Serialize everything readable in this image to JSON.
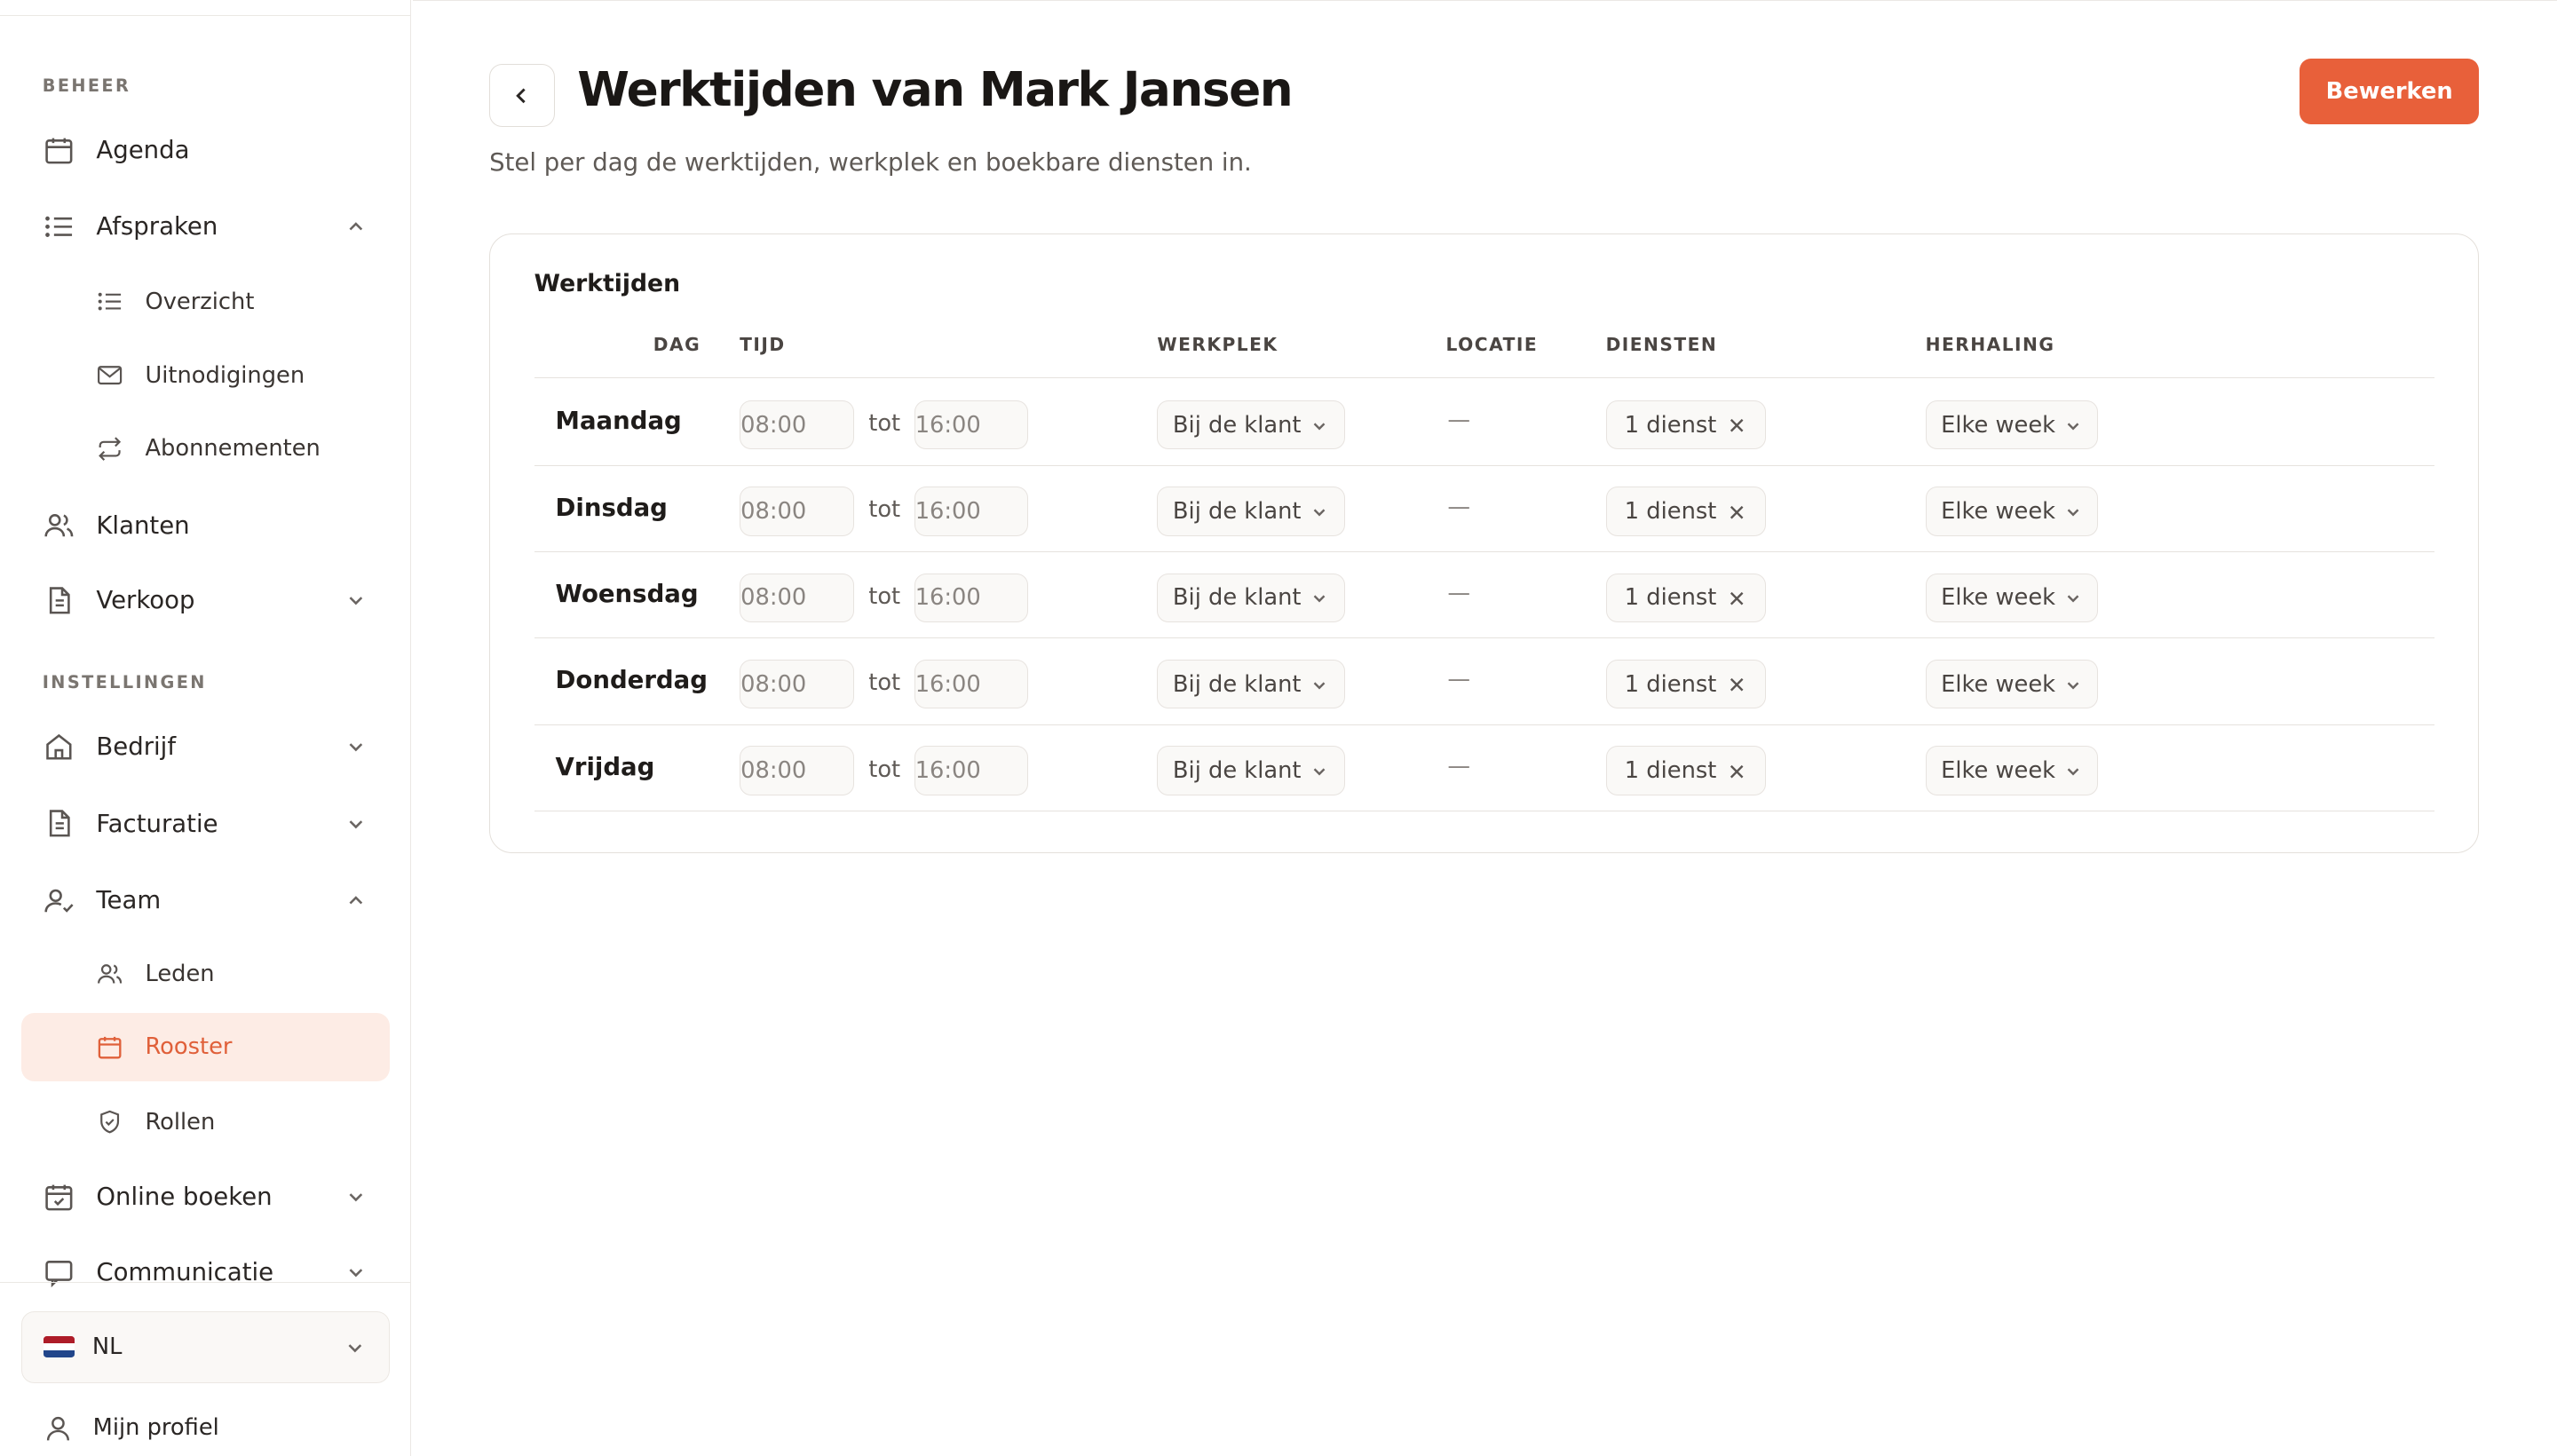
{
  "sidebar": {
    "section_beheer": "BEHEER",
    "section_instellingen": "INSTELLINGEN",
    "items": {
      "agenda": "Agenda",
      "afspraken": "Afspraken",
      "overzicht": "Overzicht",
      "uitnodigingen": "Uitnodigingen",
      "abonnementen": "Abonnementen",
      "klanten": "Klanten",
      "verkoop": "Verkoop",
      "bedrijf": "Bedrijf",
      "facturatie": "Facturatie",
      "team": "Team",
      "leden": "Leden",
      "rooster": "Rooster",
      "rollen": "Rollen",
      "online_boeken": "Online boeken",
      "communicatie": "Communicatie"
    },
    "language": "NL",
    "profile": "Mijn profiel"
  },
  "page": {
    "title": "Werktijden van Mark Jansen",
    "subtitle": "Stel per dag de werktijden, werkplek en boekbare diensten in.",
    "edit_label": "Bewerken"
  },
  "card": {
    "title": "Werktijden",
    "headers": {
      "dag": "DAG",
      "tijd": "TIJD",
      "werkplek": "WERKPLEK",
      "locatie": "LOCATIE",
      "diensten": "DIENSTEN",
      "herhaling": "HERHALING"
    },
    "separator": "tot",
    "rows": [
      {
        "day": "Maandag",
        "start": "08:00",
        "end": "16:00",
        "werkplek": "Bij de klant",
        "locatie": "—",
        "diensten": "1 dienst",
        "herhaling": "Elke week"
      },
      {
        "day": "Dinsdag",
        "start": "08:00",
        "end": "16:00",
        "werkplek": "Bij de klant",
        "locatie": "—",
        "diensten": "1 dienst",
        "herhaling": "Elke week"
      },
      {
        "day": "Woensdag",
        "start": "08:00",
        "end": "16:00",
        "werkplek": "Bij de klant",
        "locatie": "—",
        "diensten": "1 dienst",
        "herhaling": "Elke week"
      },
      {
        "day": "Donderdag",
        "start": "08:00",
        "end": "16:00",
        "werkplek": "Bij de klant",
        "locatie": "—",
        "diensten": "1 dienst",
        "herhaling": "Elke week"
      },
      {
        "day": "Vrijdag",
        "start": "08:00",
        "end": "16:00",
        "werkplek": "Bij de klant",
        "locatie": "—",
        "diensten": "1 dienst",
        "herhaling": "Elke week"
      }
    ]
  },
  "colors": {
    "accent": "#e8603a",
    "active_bg": "#fdece5"
  }
}
